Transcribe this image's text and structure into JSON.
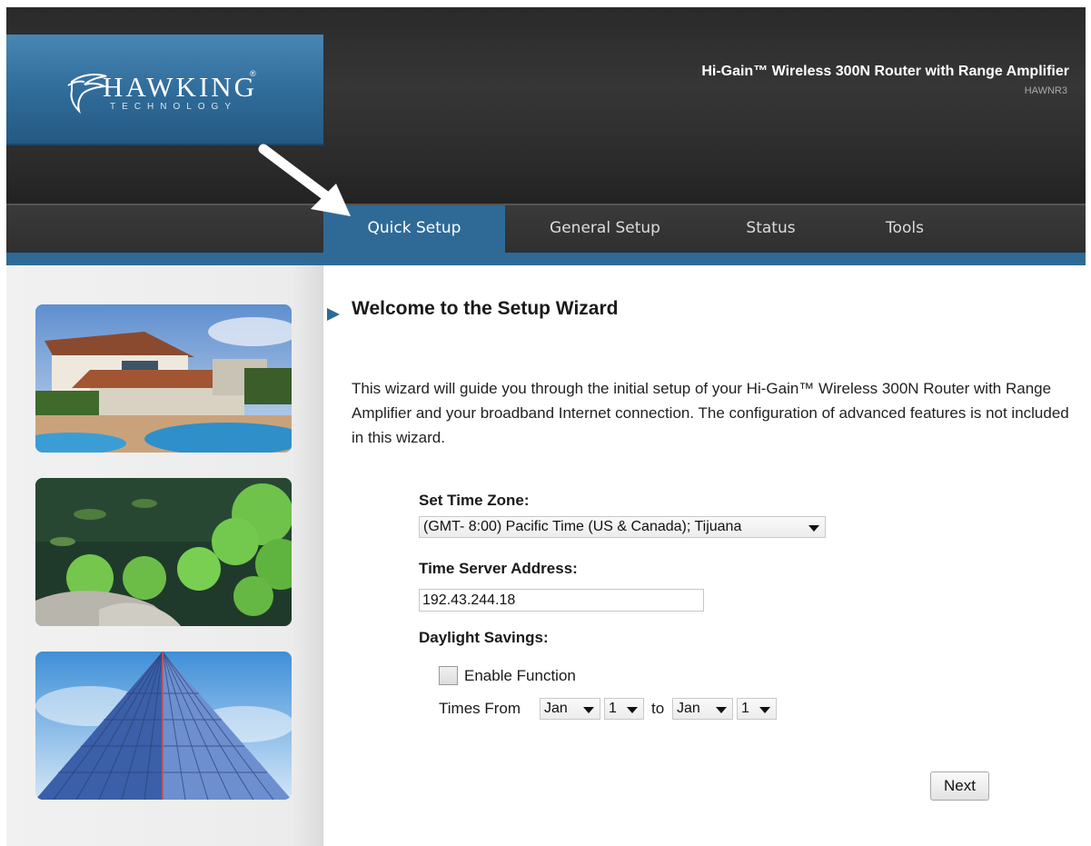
{
  "header": {
    "logo_text": "HAWKING",
    "logo_reg": "®",
    "logo_sub": "TECHNOLOGY",
    "product_title": "Hi-Gain™ Wireless 300N Router with Range Amplifier",
    "product_model": "HAWNR3"
  },
  "nav": {
    "items": [
      {
        "label": "Quick Setup",
        "active": true
      },
      {
        "label": "General Setup",
        "active": false
      },
      {
        "label": "Status",
        "active": false
      },
      {
        "label": "Tools",
        "active": false
      }
    ]
  },
  "sidebar": {
    "photos": [
      "house-with-pool-photo",
      "lily-pond-photo",
      "glass-building-photo"
    ]
  },
  "main": {
    "title": "Welcome to the Setup Wizard",
    "intro": "This wizard will guide you through the initial setup of your Hi-Gain™ Wireless 300N Router with Range Amplifier and your broadband Internet connection. The configuration of advanced features is not included in this wizard.",
    "time_zone": {
      "label": "Set Time Zone:",
      "selected": "(GMT- 8:00) Pacific Time (US & Canada); Tijuana"
    },
    "time_server": {
      "label": "Time Server Address:",
      "value": "192.43.244.18"
    },
    "daylight": {
      "label": "Daylight Savings:",
      "enable_label": "Enable Function",
      "enabled": false,
      "times_from_label": "Times From",
      "from_month": "Jan",
      "from_day": "1",
      "to_label": "to",
      "to_month": "Jan",
      "to_day": "1"
    },
    "next_label": "Next"
  },
  "colors": {
    "accent_blue": "#2f6a97",
    "header_dark": "#2c2c2c"
  }
}
